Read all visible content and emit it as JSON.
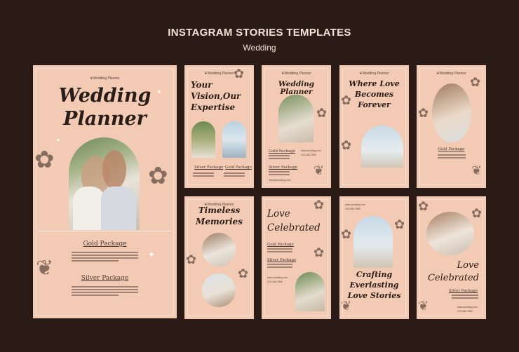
{
  "header": {
    "title": "INSTAGRAM STORIES TEMPLATES",
    "subtitle": "Wedding"
  },
  "colors": {
    "background": "#2b1b16",
    "card": "#f3cbb4",
    "text": "#2a1d18"
  },
  "main_card": {
    "title_line1": "Wedding",
    "title_line2": "Planner",
    "gold": "Gold Package",
    "silver": "Silver Package"
  },
  "cards": {
    "c1": {
      "brand": "Wedding Planner",
      "title_line1": "Your",
      "title_line2": "Vision,Our",
      "title_line3": "Expertise",
      "pkg1": "Silver Package",
      "pkg2": "Gold Package"
    },
    "c2": {
      "brand": "Wedding Planner",
      "title": "Wedding Planner",
      "pkg1": "Gold Package",
      "pkg2": "Silver Package",
      "web": "www.wedding.com",
      "phone": "123-456-7890",
      "email": "hello@wedding.com"
    },
    "c3": {
      "brand": "Wedding Planner",
      "title_line1": "Where Love",
      "title_line2": "Becomes",
      "title_line3": "Forever"
    },
    "c4": {
      "brand": "Wedding Planner",
      "pkg": "Gold Package"
    },
    "c5": {
      "brand": "Wedding Planner",
      "title_line1": "Timeless",
      "title_line2": "Memories"
    },
    "c6": {
      "title_line1": "Love",
      "title_line2": "Celebrated",
      "pkg1": "Gold Package",
      "pkg2": "Silver Package",
      "web": "www.wedding.com",
      "phone": "123-456-7890"
    },
    "c7": {
      "web": "www.wedding.com",
      "phone": "123-456-7890",
      "title_line1": "Crafting",
      "title_line2": "Everlasting",
      "title_line3": "Love Stories"
    },
    "c8": {
      "title_line1": "Love",
      "title_line2": "Celebrated",
      "pkg": "Silver Package",
      "web": "www.wedding.com",
      "phone": "123-456-7890"
    }
  }
}
